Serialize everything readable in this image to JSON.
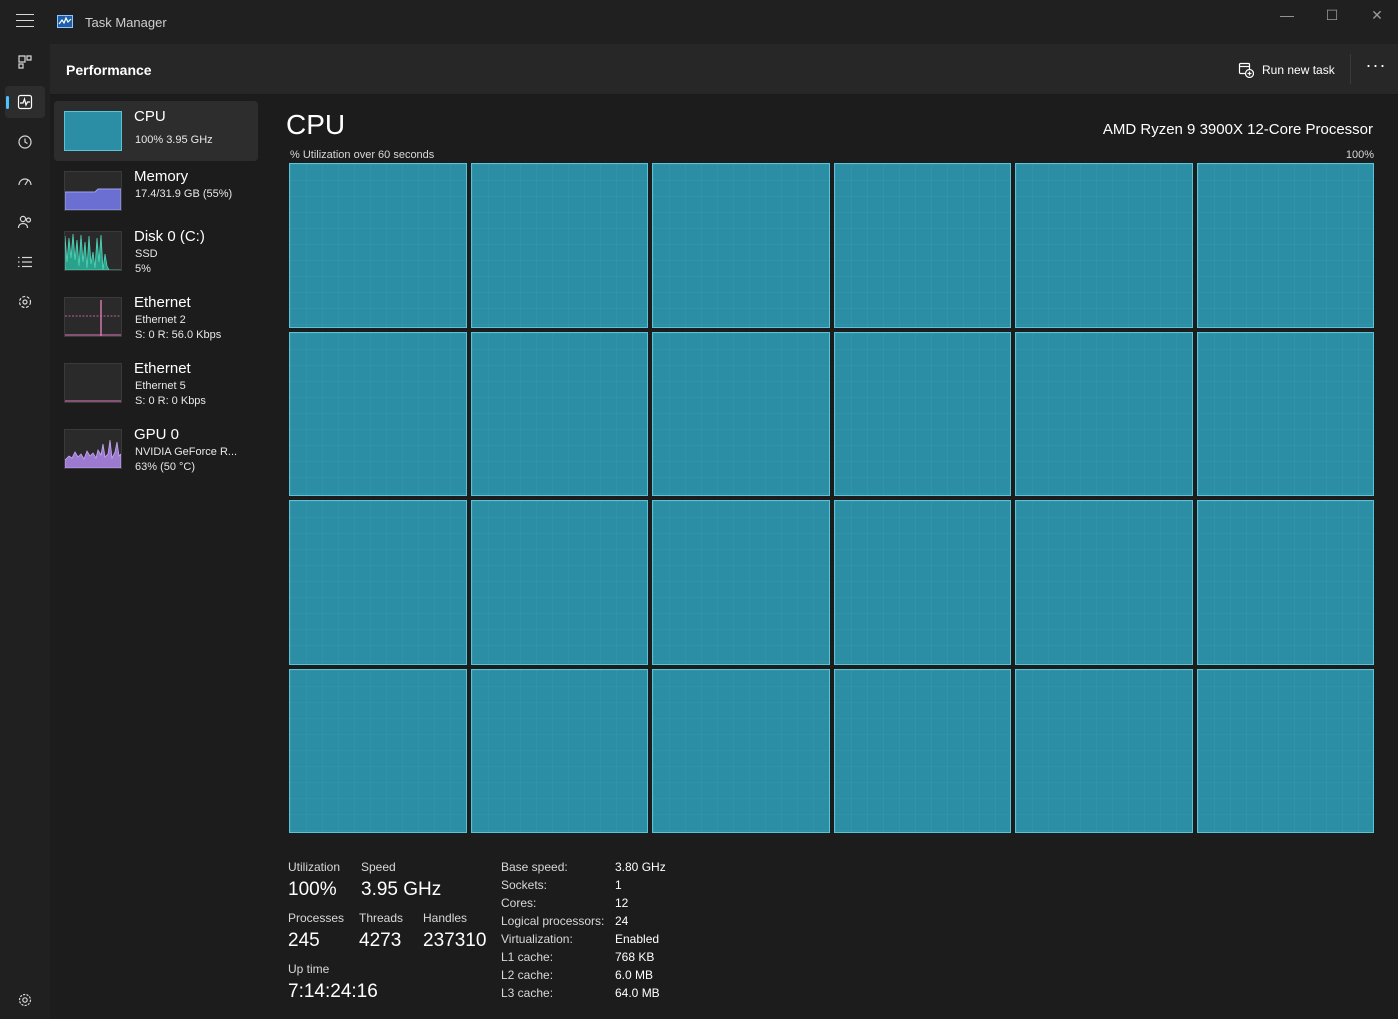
{
  "window": {
    "title": "Task Manager"
  },
  "header": {
    "title": "Performance",
    "run_task_label": "Run new task",
    "more_label": "···"
  },
  "window_controls": {
    "minimize": "—",
    "maximize": "☐",
    "close": "✕"
  },
  "nav": [
    "menu-icon",
    "processes-icon",
    "performance-icon",
    "app-history-icon",
    "startup-apps-icon",
    "users-icon",
    "details-icon",
    "services-icon",
    "settings-icon"
  ],
  "sidebar": {
    "items": [
      {
        "title": "CPU",
        "sub1": "100%  3.95 GHz",
        "sub2": "",
        "sub3": "",
        "color": "#2b8ea4"
      },
      {
        "title": "Memory",
        "sub1": "17.4/31.9 GB (55%)",
        "sub2": "",
        "sub3": "",
        "color": "#6b6fd1"
      },
      {
        "title": "Disk 0 (C:)",
        "sub1": "SSD",
        "sub2": "5%",
        "sub3": "",
        "color": "#2aa18a"
      },
      {
        "title": "Ethernet",
        "sub1": "Ethernet 2",
        "sub2": "S: 0  R: 56.0 Kbps",
        "sub3": "",
        "color": "#e27ab8"
      },
      {
        "title": "Ethernet",
        "sub1": "Ethernet 5",
        "sub2": "S: 0  R: 0 Kbps",
        "sub3": "",
        "color": "#e27ab8"
      },
      {
        "title": "GPU 0",
        "sub1": "NVIDIA GeForce R...",
        "sub2": "63%  (50 °C)",
        "sub3": "",
        "color": "#9b7ad0"
      }
    ]
  },
  "main": {
    "title": "CPU",
    "processor": "AMD Ryzen 9 3900X 12-Core Processor",
    "graph_label": "% Utilization over 60 seconds",
    "graph_max": "100%",
    "logical_processors_graphs": 24
  },
  "stats": {
    "utilization": {
      "label": "Utilization",
      "value": "100%"
    },
    "speed": {
      "label": "Speed",
      "value": "3.95 GHz"
    },
    "processes": {
      "label": "Processes",
      "value": "245"
    },
    "threads": {
      "label": "Threads",
      "value": "4273"
    },
    "handles": {
      "label": "Handles",
      "value": "237310"
    },
    "uptime": {
      "label": "Up time",
      "value": "7:14:24:16"
    }
  },
  "specs": [
    {
      "key": "Base speed:",
      "value": "3.80 GHz"
    },
    {
      "key": "Sockets:",
      "value": "1"
    },
    {
      "key": "Cores:",
      "value": "12"
    },
    {
      "key": "Logical processors:",
      "value": "24"
    },
    {
      "key": "Virtualization:",
      "value": "Enabled"
    },
    {
      "key": "L1 cache:",
      "value": "768 KB"
    },
    {
      "key": "L2 cache:",
      "value": "6.0 MB"
    },
    {
      "key": "L3 cache:",
      "value": "64.0 MB"
    }
  ]
}
